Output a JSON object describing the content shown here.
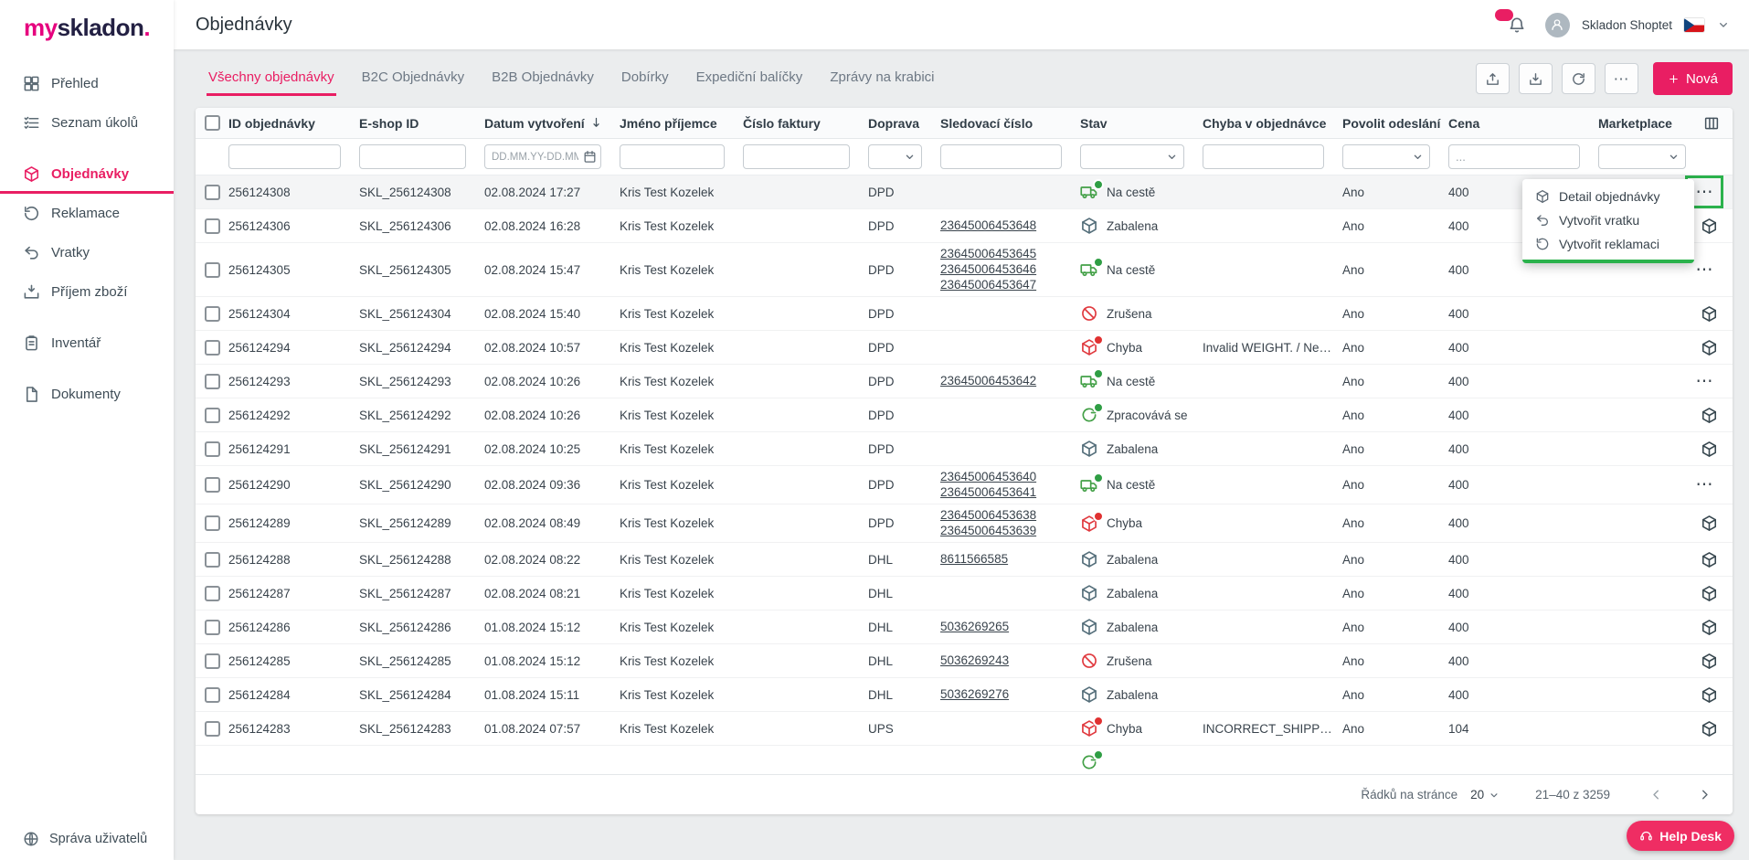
{
  "colors": {
    "accent": "#e91e63",
    "logo_pink": "#e6007e",
    "annotation_green": "#2bb24c",
    "status_green": "#43a047",
    "status_red": "#e0393e",
    "status_slate": "#546e7a"
  },
  "brand": {
    "logo_prefix": "my",
    "logo_main": "skladon",
    "logo_suffix": "."
  },
  "sidebar": {
    "active_index": 2,
    "items": [
      {
        "name": "prehled",
        "icon": "grid",
        "label": "Přehled"
      },
      {
        "name": "seznam-ukolu",
        "icon": "tasks",
        "label": "Seznam úkolů"
      },
      {
        "name": "objednavky",
        "icon": "cube",
        "label": "Objednávky"
      },
      {
        "name": "reklamace",
        "icon": "rotate",
        "label": "Reklamace"
      },
      {
        "name": "vratky",
        "icon": "return",
        "label": "Vratky"
      },
      {
        "name": "prijem-zbozi",
        "icon": "inbox",
        "label": "Příjem zboží"
      },
      {
        "name": "inventar",
        "icon": "clipboard",
        "label": "Inventář"
      },
      {
        "name": "dokumenty",
        "icon": "doc",
        "label": "Dokumenty"
      }
    ],
    "footer_label": "Správa uživatelů"
  },
  "header": {
    "title": "Objednávky",
    "user_name": "Skladon Shoptet"
  },
  "tabs": {
    "active_index": 0,
    "items": [
      "Všechny objednávky",
      "B2C Objednávky",
      "B2B Objednávky",
      "Dobírky",
      "Expediční balíčky",
      "Zprávy na krabici"
    ]
  },
  "toolbar": {
    "new_label": "Nová"
  },
  "table": {
    "columns": [
      "ID objednávky",
      "E-shop ID",
      "Datum vytvoření",
      "Jméno příjemce",
      "Číslo faktury",
      "Doprava",
      "Sledovací číslo",
      "Stav",
      "Chyba v objednávce",
      "Povolit odeslání",
      "Cena",
      "Marketplace"
    ],
    "sort_column": "Datum vytvoření",
    "filters": {
      "date_placeholder": "DD.MM.YY-DD.MM.YY",
      "price_placeholder": "..."
    },
    "rows": [
      {
        "id": "256124308",
        "eshop_id": "SKL_256124308",
        "created": "02.08.2024 17:27",
        "recipient": "Kris Test Kozelek",
        "invoice": "",
        "carrier": "DPD",
        "tracking": [],
        "status": {
          "label": "Na cestě",
          "type": "na-ceste"
        },
        "error": "",
        "allow": "Ano",
        "price": "400",
        "action": "menu",
        "highlight": true
      },
      {
        "id": "256124306",
        "eshop_id": "SKL_256124306",
        "created": "02.08.2024 16:28",
        "recipient": "Kris Test Kozelek",
        "invoice": "",
        "carrier": "DPD",
        "tracking": [
          "23645006453648"
        ],
        "status": {
          "label": "Zabalena",
          "type": "zabalena"
        },
        "error": "",
        "allow": "Ano",
        "price": "400",
        "action": "marketplace"
      },
      {
        "id": "256124305",
        "eshop_id": "SKL_256124305",
        "created": "02.08.2024 15:47",
        "recipient": "Kris Test Kozelek",
        "invoice": "",
        "carrier": "DPD",
        "tracking": [
          "23645006453645",
          "23645006453646",
          "23645006453647"
        ],
        "status": {
          "label": "Na cestě",
          "type": "na-ceste"
        },
        "error": "",
        "allow": "Ano",
        "price": "400",
        "action": "menu"
      },
      {
        "id": "256124304",
        "eshop_id": "SKL_256124304",
        "created": "02.08.2024 15:40",
        "recipient": "Kris Test Kozelek",
        "invoice": "",
        "carrier": "DPD",
        "tracking": [],
        "status": {
          "label": "Zrušena",
          "type": "zrusena"
        },
        "error": "",
        "allow": "Ano",
        "price": "400",
        "action": "marketplace"
      },
      {
        "id": "256124294",
        "eshop_id": "SKL_256124294",
        "created": "02.08.2024 10:57",
        "recipient": "Kris Test Kozelek",
        "invoice": "",
        "carrier": "DPD",
        "tracking": [],
        "status": {
          "label": "Chyba",
          "type": "chyba"
        },
        "error": "Invalid WEIGHT. / Neplat...",
        "allow": "Ano",
        "price": "400",
        "action": "marketplace"
      },
      {
        "id": "256124293",
        "eshop_id": "SKL_256124293",
        "created": "02.08.2024 10:26",
        "recipient": "Kris Test Kozelek",
        "invoice": "",
        "carrier": "DPD",
        "tracking": [
          "23645006453642"
        ],
        "status": {
          "label": "Na cestě",
          "type": "na-ceste"
        },
        "error": "",
        "allow": "Ano",
        "price": "400",
        "action": "menu"
      },
      {
        "id": "256124292",
        "eshop_id": "SKL_256124292",
        "created": "02.08.2024 10:26",
        "recipient": "Kris Test Kozelek",
        "invoice": "",
        "carrier": "DPD",
        "tracking": [],
        "status": {
          "label": "Zpracovává se",
          "type": "zpracovava"
        },
        "error": "",
        "allow": "Ano",
        "price": "400",
        "action": "marketplace"
      },
      {
        "id": "256124291",
        "eshop_id": "SKL_256124291",
        "created": "02.08.2024 10:25",
        "recipient": "Kris Test Kozelek",
        "invoice": "",
        "carrier": "DPD",
        "tracking": [],
        "status": {
          "label": "Zabalena",
          "type": "zabalena"
        },
        "error": "",
        "allow": "Ano",
        "price": "400",
        "action": "marketplace"
      },
      {
        "id": "256124290",
        "eshop_id": "SKL_256124290",
        "created": "02.08.2024 09:36",
        "recipient": "Kris Test Kozelek",
        "invoice": "",
        "carrier": "DPD",
        "tracking": [
          "23645006453640",
          "23645006453641"
        ],
        "status": {
          "label": "Na cestě",
          "type": "na-ceste"
        },
        "error": "",
        "allow": "Ano",
        "price": "400",
        "action": "menu"
      },
      {
        "id": "256124289",
        "eshop_id": "SKL_256124289",
        "created": "02.08.2024 08:49",
        "recipient": "Kris Test Kozelek",
        "invoice": "",
        "carrier": "DPD",
        "tracking": [
          "23645006453638",
          "23645006453639"
        ],
        "status": {
          "label": "Chyba",
          "type": "chyba"
        },
        "error": "",
        "allow": "Ano",
        "price": "400",
        "action": "marketplace"
      },
      {
        "id": "256124288",
        "eshop_id": "SKL_256124288",
        "created": "02.08.2024 08:22",
        "recipient": "Kris Test Kozelek",
        "invoice": "",
        "carrier": "DHL",
        "tracking": [
          "8611566585"
        ],
        "status": {
          "label": "Zabalena",
          "type": "zabalena"
        },
        "error": "",
        "allow": "Ano",
        "price": "400",
        "action": "marketplace"
      },
      {
        "id": "256124287",
        "eshop_id": "SKL_256124287",
        "created": "02.08.2024 08:21",
        "recipient": "Kris Test Kozelek",
        "invoice": "",
        "carrier": "DHL",
        "tracking": [],
        "status": {
          "label": "Zabalena",
          "type": "zabalena"
        },
        "error": "",
        "allow": "Ano",
        "price": "400",
        "action": "marketplace"
      },
      {
        "id": "256124286",
        "eshop_id": "SKL_256124286",
        "created": "01.08.2024 15:12",
        "recipient": "Kris Test Kozelek",
        "invoice": "",
        "carrier": "DHL",
        "tracking": [
          "5036269265"
        ],
        "status": {
          "label": "Zabalena",
          "type": "zabalena"
        },
        "error": "",
        "allow": "Ano",
        "price": "400",
        "action": "marketplace"
      },
      {
        "id": "256124285",
        "eshop_id": "SKL_256124285",
        "created": "01.08.2024 15:12",
        "recipient": "Kris Test Kozelek",
        "invoice": "",
        "carrier": "DHL",
        "tracking": [
          "5036269243"
        ],
        "status": {
          "label": "Zrušena",
          "type": "zrusena"
        },
        "error": "",
        "allow": "Ano",
        "price": "400",
        "action": "marketplace"
      },
      {
        "id": "256124284",
        "eshop_id": "SKL_256124284",
        "created": "01.08.2024 15:11",
        "recipient": "Kris Test Kozelek",
        "invoice": "",
        "carrier": "DHL",
        "tracking": [
          "5036269276"
        ],
        "status": {
          "label": "Zabalena",
          "type": "zabalena"
        },
        "error": "",
        "allow": "Ano",
        "price": "400",
        "action": "marketplace"
      },
      {
        "id": "256124283",
        "eshop_id": "SKL_256124283",
        "created": "01.08.2024 07:57",
        "recipient": "Kris Test Kozelek",
        "invoice": "",
        "carrier": "UPS",
        "tracking": [],
        "status": {
          "label": "Chyba",
          "type": "chyba"
        },
        "error": "INCORRECT_SHIPPIN...",
        "allow": "Ano",
        "price": "104",
        "action": "marketplace"
      },
      {
        "id": "",
        "eshop_id": "",
        "created": "",
        "recipient": "",
        "invoice": "",
        "carrier": "",
        "tracking": [],
        "status": {
          "label": "",
          "type": "zpracovava"
        },
        "error": "",
        "allow": "",
        "price": "",
        "action": "",
        "partial": true
      }
    ]
  },
  "menu": {
    "items": [
      {
        "name": "detail-objednavky",
        "icon": "cube",
        "label": "Detail objednávky"
      },
      {
        "name": "vytvorit-vratku",
        "icon": "return",
        "label": "Vytvořit vratku"
      },
      {
        "name": "vytvorit-reklamaci",
        "icon": "rotate",
        "label": "Vytvořit reklamaci"
      }
    ]
  },
  "pagination": {
    "rows_label": "Řádků na stránce",
    "page_size": "20",
    "range": "21–40 z 3259"
  },
  "help": {
    "label": "Help Desk"
  }
}
